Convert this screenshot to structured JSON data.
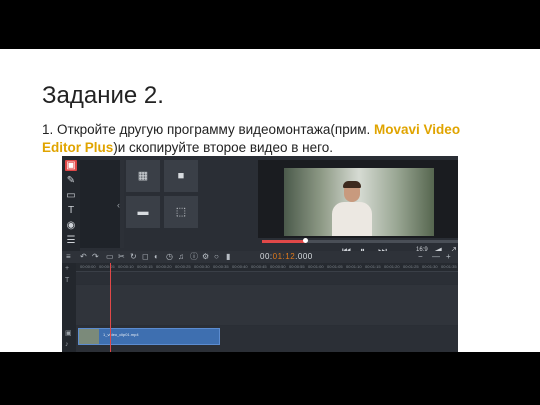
{
  "slide": {
    "title": "Задание 2.",
    "instruction_prefix": "1. Откройте другую программу видеомонтажа(прим. ",
    "instruction_app": "Movavi Video Editor Plus",
    "instruction_suffix": ")и скопируйте второе видео в него.",
    "accent_color": "#e0a400"
  },
  "editor": {
    "timecode_prefix": "00:",
    "timecode_main": "01:12",
    "timecode_ms": ".000",
    "quality_label": "16:9",
    "clip_label": "1_video_clip01.mp4",
    "playback_progress": 0.22,
    "ruler_ticks": [
      "00:00:00",
      "00:00:05",
      "00:00:10",
      "00:00:15",
      "00:00:20",
      "00:00:25",
      "00:00:30",
      "00:00:35",
      "00:00:40",
      "00:00:45",
      "00:00:50",
      "00:00:55",
      "00:01:00",
      "00:01:05",
      "00:01:10",
      "00:01:15",
      "00:01:20",
      "00:01:25",
      "00:01:30",
      "00:01:35"
    ],
    "left_tools": [
      "video-icon",
      "magic-wand-icon",
      "transition-icon",
      "text-icon",
      "filter-icon",
      "menu-icon"
    ],
    "tiles": [
      "grid-icon",
      "camera-icon",
      "folder-icon",
      "crop-icon"
    ],
    "colors": {
      "accent_red": "#e04848",
      "timecode_orange": "#e07a1c",
      "clip_blue": "#3e6fb0"
    }
  }
}
